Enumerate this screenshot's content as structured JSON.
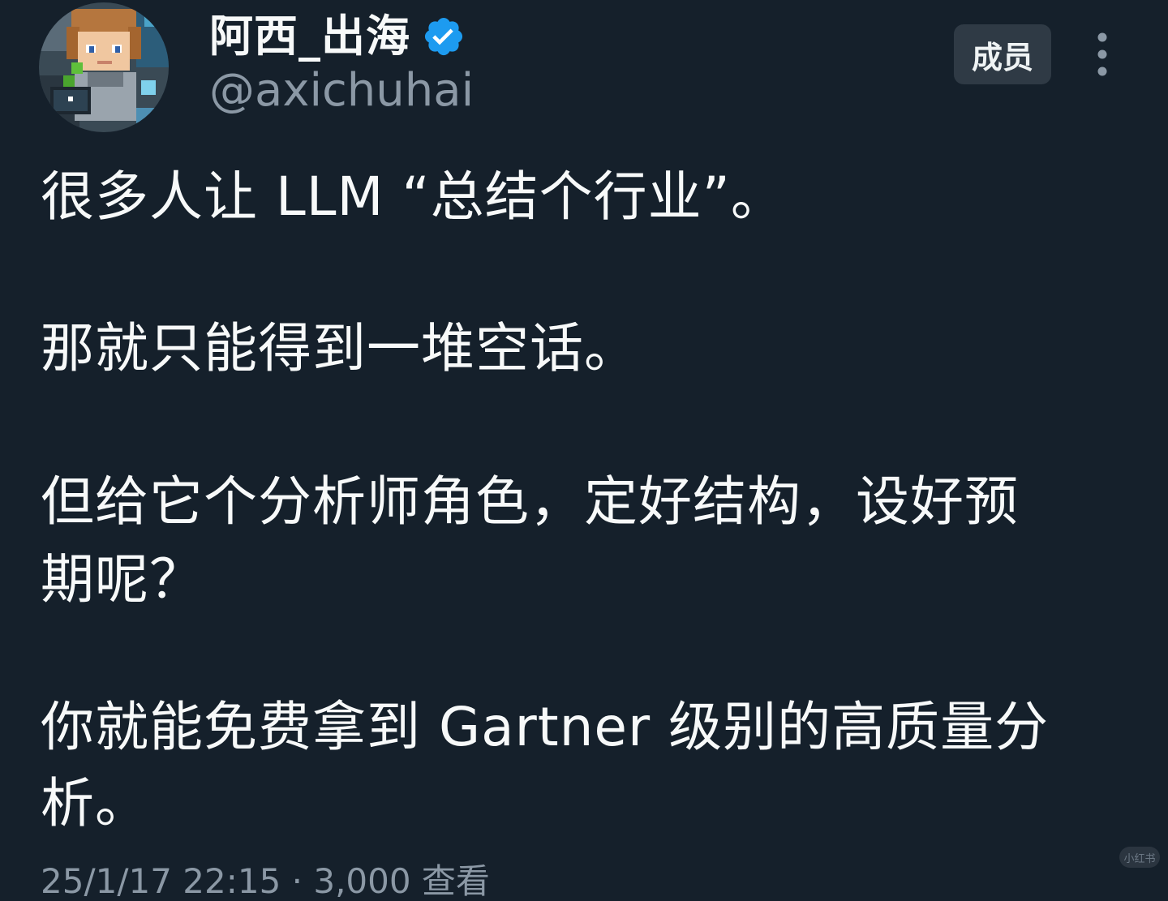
{
  "author": {
    "display_name": "阿西_出海",
    "handle": "@axichuhai",
    "verified": true,
    "avatar": "minecraft-style-character-avatar"
  },
  "actions": {
    "member_label": "成员",
    "more_icon": "more-vertical-icon"
  },
  "tweet": {
    "paragraphs": [
      "很多人让 LLM “总结个行业”。",
      "那就只能得到一堆空话。",
      "但给它个分析师角色，定好结构，设好预",
      "期呢？",
      "你就能免费拿到 Gartner 级别的高质量分",
      "析。"
    ]
  },
  "meta": {
    "partial_line": "25/1/17 22:15 · 3,000 查看"
  },
  "watermark": "小红书",
  "colors": {
    "background": "#15202b",
    "text": "#f7f9f9",
    "secondary_text": "#8b98a5",
    "verified_blue": "#1d9bf0",
    "button_bg": "#2f3a45"
  }
}
